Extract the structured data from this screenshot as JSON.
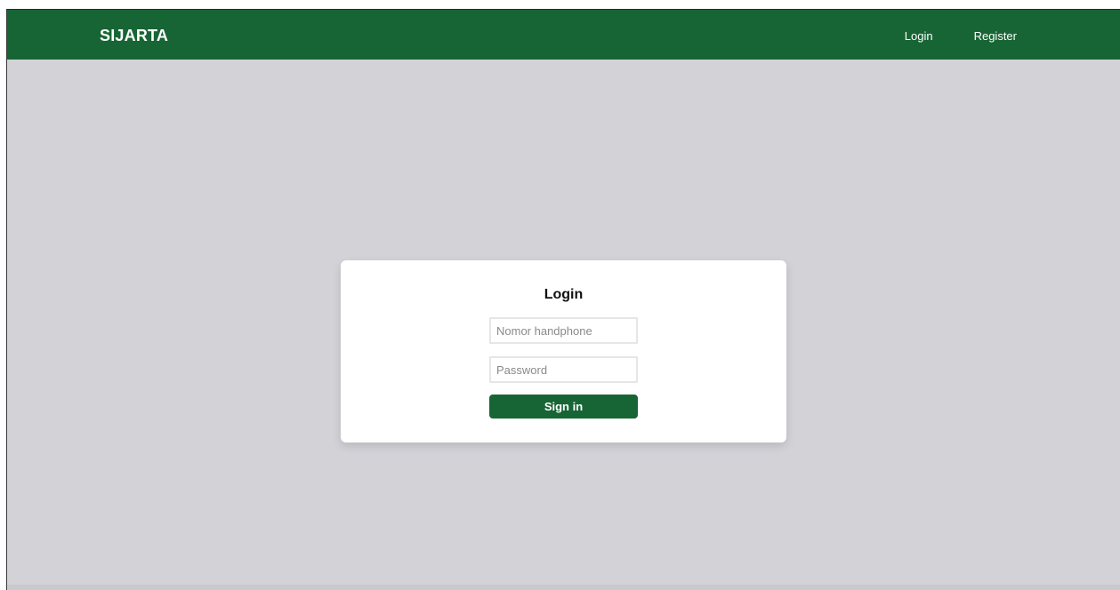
{
  "navbar": {
    "brand": "SIJARTA",
    "links": [
      {
        "label": "Login"
      },
      {
        "label": "Register"
      }
    ]
  },
  "login_card": {
    "title": "Login",
    "phone_placeholder": "Nomor handphone",
    "password_placeholder": "Password",
    "submit_label": "Sign in"
  },
  "colors": {
    "primary_green": "#176534",
    "background": "#d2d2d7",
    "card": "#ffffff"
  }
}
